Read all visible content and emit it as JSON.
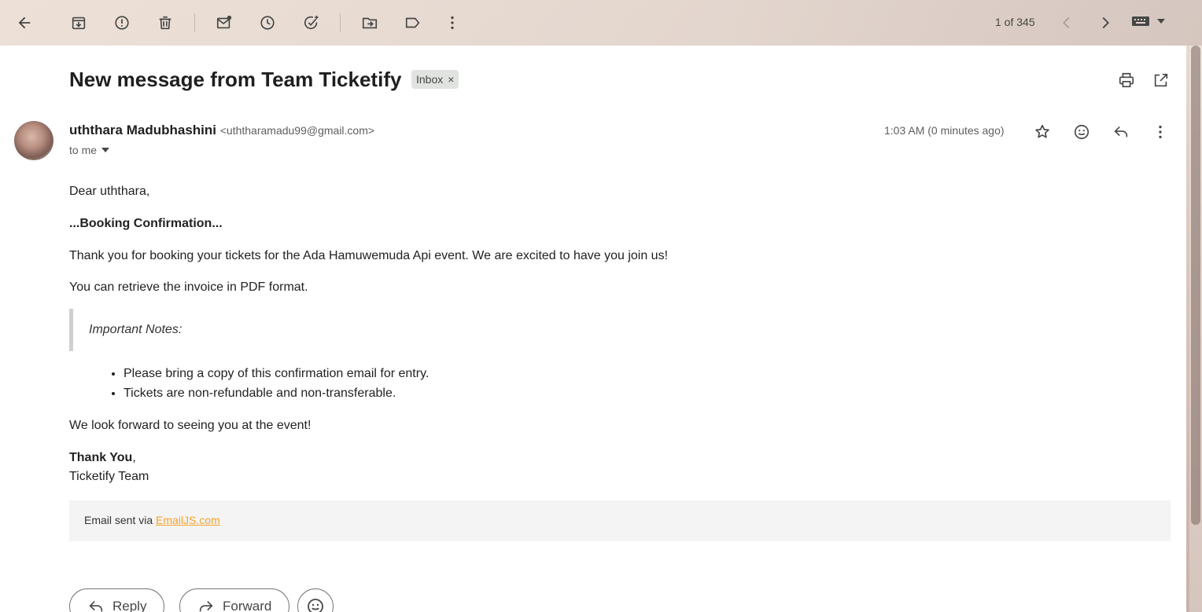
{
  "toolbar": {
    "pager_text": "1 of 345",
    "icons": [
      "back-arrow-icon",
      "archive-icon",
      "report-spam-icon",
      "delete-icon",
      "mark-unread-icon",
      "snooze-icon",
      "add-task-icon",
      "move-to-icon",
      "label-icon",
      "more-vert-icon",
      "newer-icon",
      "older-icon",
      "keyboard-icon"
    ]
  },
  "email": {
    "subject": "New message from Team Ticketify",
    "label": "Inbox",
    "label_close": "×",
    "sender_name": "uththara Madubhashini",
    "sender_email": "<uththaramadu99@gmail.com>",
    "recipient": "to me",
    "time": "1:03 AM (0 minutes ago)"
  },
  "body": {
    "greeting": "Dear uththara,",
    "heading": "...Booking Confirmation...",
    "thanks_line": "Thank you for booking your tickets for the Ada Hamuwemuda Api event. We are excited to have you join us!",
    "invoice_line": "You can retrieve the invoice in PDF format.",
    "notes_title": "Important Notes:",
    "notes": [
      "Please bring a copy of this confirmation email for entry.",
      "Tickets are non-refundable and non-transferable."
    ],
    "closing_line": "We look forward to seeing you at the event!",
    "signoff_bold": "Thank You",
    "signoff_comma": ",",
    "team": "Ticketify Team"
  },
  "footer": {
    "prefix": "Email sent via ",
    "link": "EmailJS.com"
  },
  "actions": {
    "reply": "Reply",
    "forward": "Forward"
  }
}
